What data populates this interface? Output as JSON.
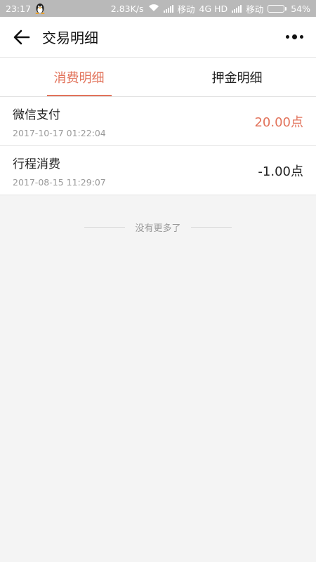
{
  "status_bar": {
    "time": "23:17",
    "speed": "2.83K/s",
    "carrier1": "移动",
    "network": "4G HD",
    "carrier2": "移动",
    "battery": "54%",
    "battery_level": 0.54
  },
  "header": {
    "title": "交易明细"
  },
  "tabs": [
    {
      "label": "消费明细",
      "active": true
    },
    {
      "label": "押金明细",
      "active": false
    }
  ],
  "transactions": [
    {
      "name": "微信支付",
      "time": "2017-10-17 01:22:04",
      "amount": "20.00点"
    },
    {
      "name": "行程消费",
      "time": "2017-08-15 11:29:07",
      "amount": "-1.00点"
    }
  ],
  "end_note": "没有更多了",
  "colors": {
    "accent": "#e2735b",
    "status_bar_bg": "#b9b9b9"
  }
}
